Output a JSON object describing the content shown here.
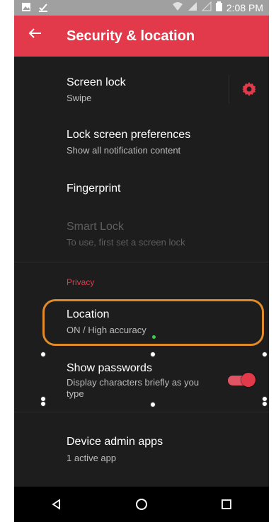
{
  "status_bar": {
    "time": "2:08 PM"
  },
  "app_bar": {
    "title": "Security & location"
  },
  "items": [
    {
      "title": "Screen lock",
      "subtitle": "Swipe"
    },
    {
      "title": "Lock screen preferences",
      "subtitle": "Show all notification content"
    },
    {
      "title": "Fingerprint",
      "subtitle": ""
    },
    {
      "title": "Smart Lock",
      "subtitle": "To use, first set a screen lock",
      "disabled": true
    },
    {
      "title": "Location",
      "subtitle": "ON / High accuracy"
    },
    {
      "title": "Show passwords",
      "subtitle": "Display characters briefly as you type",
      "toggle": "on"
    },
    {
      "title": "Device admin apps",
      "subtitle": "1 active app"
    }
  ],
  "section": {
    "privacy": "Privacy"
  },
  "colors": {
    "accent": "#e23a4a",
    "background": "#1d1d1d",
    "highlight": "#e08a2a"
  },
  "icons": [
    "back-arrow-icon",
    "gear-icon",
    "nav-back-icon",
    "nav-home-icon",
    "nav-recents-icon",
    "wifi-icon",
    "signal-icon",
    "battery-icon",
    "image-icon",
    "check-icon"
  ]
}
